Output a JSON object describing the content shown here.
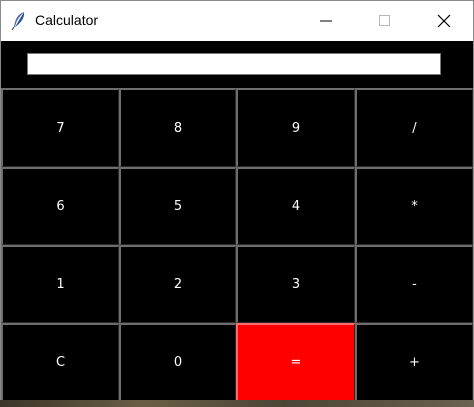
{
  "window": {
    "title": "Calculator",
    "app_icon": "feather-icon",
    "controls": [
      "minimize-icon",
      "maximize-icon",
      "close-icon"
    ]
  },
  "display": {
    "value": ""
  },
  "keys": [
    [
      "7",
      "8",
      "9",
      "/"
    ],
    [
      "6",
      "5",
      "4",
      "*"
    ],
    [
      "1",
      "2",
      "3",
      "-"
    ],
    [
      "C",
      "0",
      "=",
      "+"
    ]
  ],
  "colors": {
    "background": "#000000",
    "key_text": "#ffffff",
    "equals_key": "#ff0000",
    "titlebar": "#ffffff"
  }
}
